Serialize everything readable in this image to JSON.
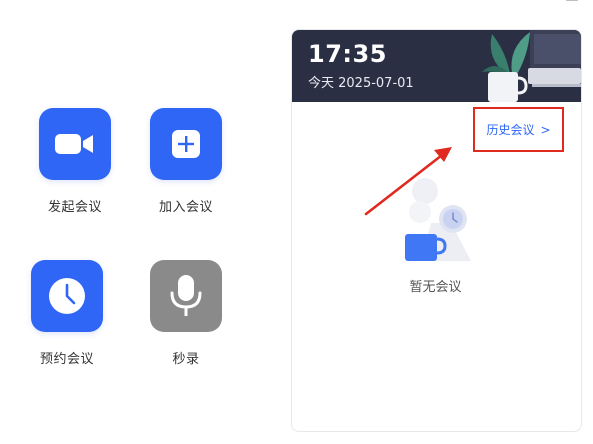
{
  "actions": [
    {
      "label": "发起会议",
      "icon": "video-camera-icon",
      "color": "#2f66f6"
    },
    {
      "label": "加入会议",
      "icon": "plus-icon",
      "color": "#2f66f6"
    },
    {
      "label": "预约会议",
      "icon": "clock-icon",
      "color": "#2f66f6"
    },
    {
      "label": "秒录",
      "icon": "microphone-icon",
      "color": "#8a8a8a"
    }
  ],
  "card": {
    "time": "17:35",
    "date": "今天 2025-07-01",
    "history_label": "历史会议",
    "history_chevron": ">",
    "empty_text": "暂无会议"
  },
  "colors": {
    "accent": "#2f66f6",
    "header_bg": "#2a2f44",
    "highlight": "#e0291f"
  }
}
